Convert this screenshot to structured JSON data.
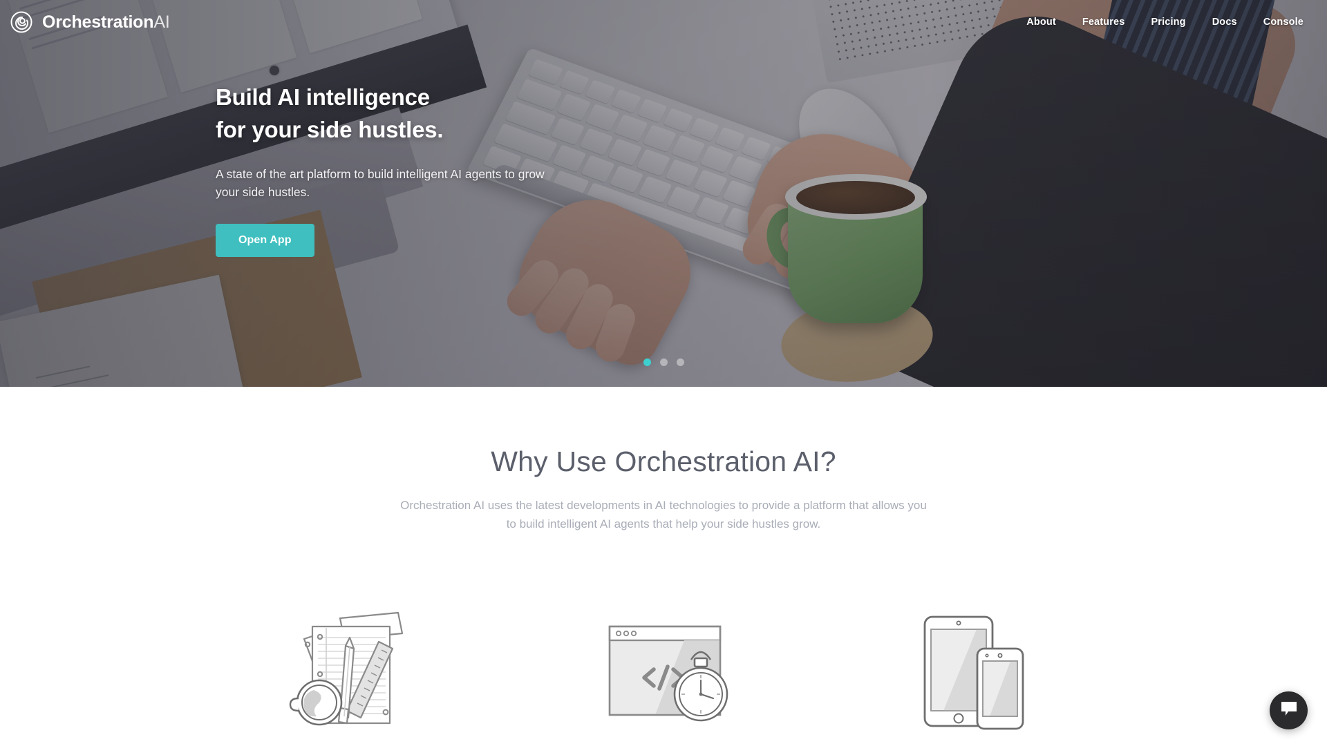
{
  "brand": {
    "name_bold": "Orchestration",
    "name_light": "AI",
    "logo_icon": "orchestration-spiral-icon"
  },
  "nav": {
    "links": [
      {
        "label": "About"
      },
      {
        "label": "Features"
      },
      {
        "label": "Pricing"
      },
      {
        "label": "Docs"
      },
      {
        "label": "Console"
      }
    ]
  },
  "hero": {
    "title_line1": "Build AI intelligence",
    "title_line2": "for your side hustles.",
    "subtitle": "A state of the art platform to build intelligent AI agents to grow your side hustles.",
    "cta_label": "Open App",
    "cta_color": "#3fbfbf",
    "carousel": {
      "slides": 3,
      "active_index": 0,
      "active_color": "#3ecfcf",
      "inactive_color": "rgba(255,255,255,0.42)"
    },
    "background_photo": "hands-typing-on-keyboard-with-coffee-mug"
  },
  "why_section": {
    "heading": "Why Use Orchestration AI?",
    "paragraph_line1": "Orchestration AI uses the latest developments in AI technologies to provide a platform that allows you",
    "paragraph_line2": "to build intelligent AI agents that help your side hustles grow.",
    "heading_color": "#5b5f6b",
    "paragraph_color": "#a9adb7",
    "features": [
      {
        "icon": "notepad-pencil-ruler-coffee-icon"
      },
      {
        "icon": "browser-code-stopwatch-icon"
      },
      {
        "icon": "tablet-phone-devices-icon"
      }
    ]
  },
  "chat_widget": {
    "icon": "chat-bubble-icon",
    "color": "#2b2b2d"
  }
}
